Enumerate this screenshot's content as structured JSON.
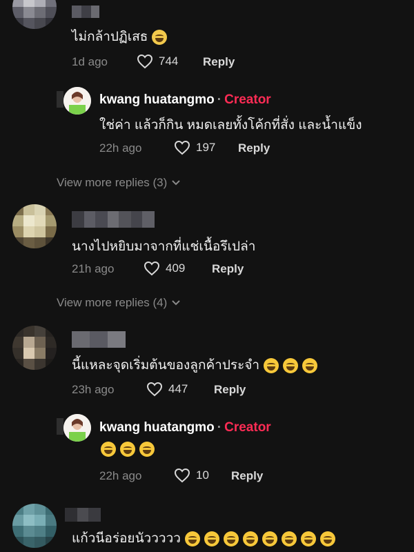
{
  "comments": [
    {
      "text": "ไม่กล้าปฏิเสธ",
      "emojis_after": 1,
      "emoji_type": "frown",
      "time": "1d ago",
      "likes": "744",
      "reply_label": "Reply"
    },
    {
      "text": "นางไปหยิบมาจากที่แช่เนื้อรึเปล่า",
      "time": "21h ago",
      "likes": "409",
      "reply_label": "Reply"
    },
    {
      "text": "นี้แหละจุดเริ่มต้นของลูกค้าประจำ",
      "time": "23h ago",
      "likes": "447",
      "reply_label": "Reply"
    },
    {
      "text": "แก้วนีอร่อยนัววววว"
    }
  ],
  "replies": [
    {
      "author": "kwang huatangmo",
      "badge": "Creator",
      "separator": "·",
      "text": "ใช่ค่า แล้วก็กิน หมดเลยทั้งโค้กที่สั่ง และน้ำแข็ง",
      "time": "22h ago",
      "likes": "197",
      "reply_label": "Reply"
    },
    {
      "author": "kwang huatangmo",
      "badge": "Creator",
      "separator": "·",
      "text": "",
      "time": "22h ago",
      "likes": "10",
      "reply_label": "Reply"
    }
  ],
  "view_more": [
    {
      "label": "View more replies (3)"
    },
    {
      "label": "View more replies (4)"
    }
  ],
  "colors": {
    "background": "#121212",
    "creator": "#fe2c55",
    "muted": "#8a8a8a"
  },
  "icons": [
    "heart-icon",
    "chevron-down-icon",
    "emoji-icon"
  ]
}
